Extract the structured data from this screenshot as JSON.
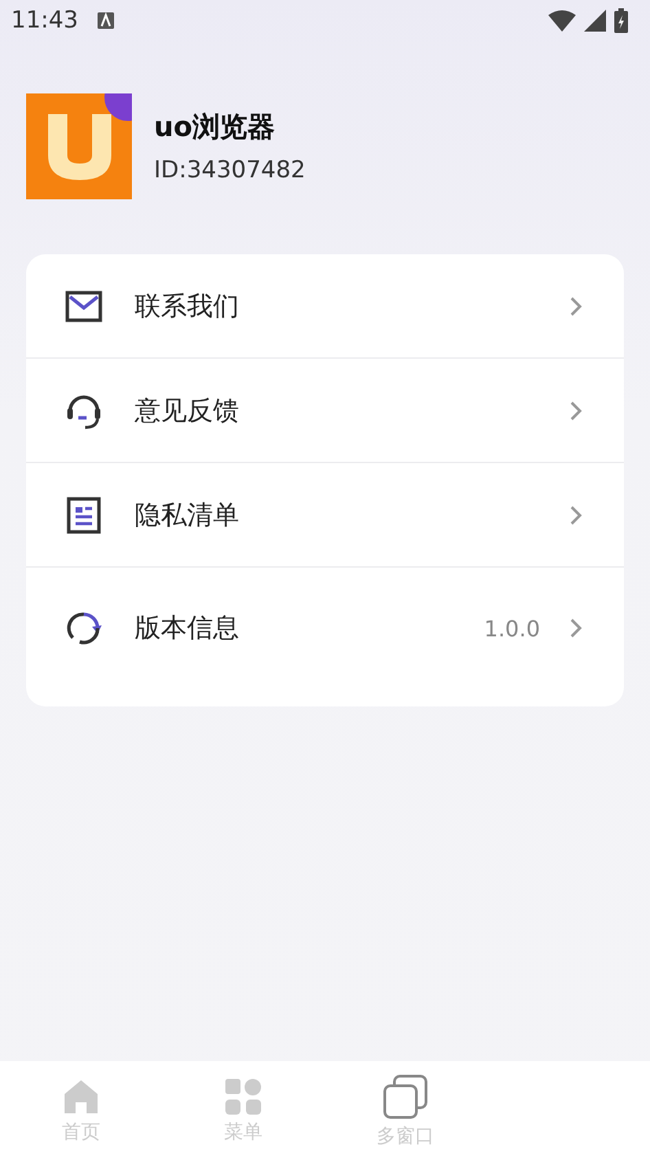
{
  "status_bar": {
    "time": "11:43"
  },
  "profile": {
    "name": "uo浏览器",
    "id": "ID:34307482"
  },
  "menu": [
    {
      "kind": "mail",
      "label": "联系我们"
    },
    {
      "kind": "headset",
      "label": "意见反馈"
    },
    {
      "kind": "document",
      "label": "隐私清单"
    },
    {
      "kind": "refresh",
      "label": "版本信息",
      "value": "1.0.0"
    }
  ],
  "tab_bar": [
    {
      "kind": "home",
      "label": "首页",
      "selected": false
    },
    {
      "kind": "grid",
      "label": "菜单",
      "selected": false
    },
    {
      "kind": "windows",
      "label": "多窗口",
      "selected": false
    }
  ]
}
